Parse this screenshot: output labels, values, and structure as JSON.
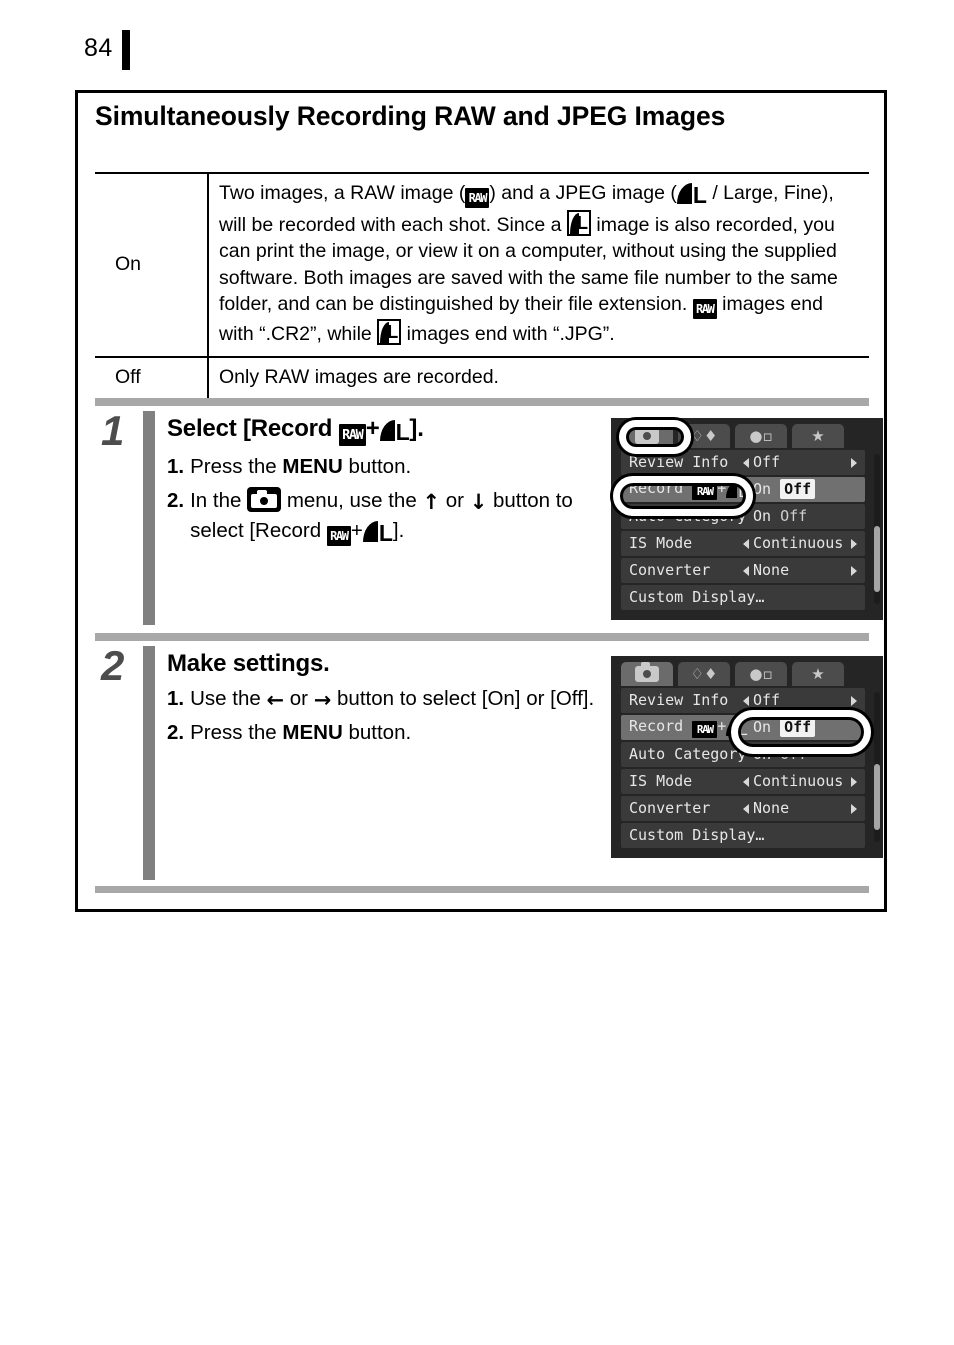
{
  "page": {
    "number": "84"
  },
  "section": {
    "title": "Simultaneously Recording RAW and JPEG Images"
  },
  "table": {
    "rows": [
      {
        "label": "On",
        "text_parts": {
          "p1": "Two images, a RAW image (",
          "p2": ") and a JPEG image (",
          "p3": "/ Large, Fine), will be recorded with each shot. Since a",
          "p4": "image is also recorded, you can print the image, or view it on a computer, without using the supplied software. Both images are saved with the same file number to the same folder, and can be distinguished by their file extension.",
          "p5": "images end with “.CR2”, while",
          "p6": "images end with “.JPG”."
        }
      },
      {
        "label": "Off",
        "text": "Only RAW images are recorded."
      }
    ]
  },
  "steps": [
    {
      "number": "1",
      "title_parts": {
        "pre": "Select [Record",
        "plus": "+",
        "post": "]."
      },
      "substeps": [
        {
          "num": "1.",
          "parts": {
            "pre": "Press the",
            "bold": "MENU",
            "post": "button."
          }
        },
        {
          "num": "2.",
          "parts": {
            "pre": "In the",
            "mid": "menu, use the",
            "or": "or",
            "post": "button to select [Record",
            "plus": "+",
            "end": "]."
          }
        }
      ]
    },
    {
      "number": "2",
      "title_parts": {
        "pre": "Make settings.",
        "plus": "",
        "post": ""
      },
      "substeps": [
        {
          "num": "1.",
          "parts": {
            "pre": "Use the",
            "or": "or",
            "post": "button to select [On] or [Off]."
          }
        },
        {
          "num": "2.",
          "parts": {
            "pre": "Press the",
            "bold": "MENU",
            "post": "button."
          }
        }
      ]
    }
  ],
  "lcd": {
    "tabs": [
      {
        "name": "shooting-tab",
        "glyph": ""
      },
      {
        "name": "setup-tab",
        "glyph": "ΨΙ"
      },
      {
        "name": "my-camera-tab",
        "glyph": "♁"
      },
      {
        "name": "favorites-tab",
        "glyph": "★"
      }
    ],
    "rows": [
      {
        "label": "Review Info",
        "value": "Off",
        "type": "arrows"
      },
      {
        "label_pre": "Record",
        "label_plus": "+",
        "value_on": "On",
        "value_off": "Off",
        "type": "toggle"
      },
      {
        "label": "Auto Category",
        "value_on": "On",
        "value_off": "Off",
        "type": "toggle-dim"
      },
      {
        "label": "IS Mode",
        "value": "Continuous",
        "type": "arrows"
      },
      {
        "label": "Converter",
        "value": "None",
        "type": "arrows"
      },
      {
        "label": "Custom Display…",
        "value": "",
        "type": "plain"
      }
    ]
  },
  "icons": {
    "raw": "RAW",
    "large_l": "L",
    "arrow_up": "↑",
    "arrow_down": "↓",
    "arrow_left": "←",
    "arrow_right": "→"
  },
  "colors": {
    "step_number": "#4d4d4d",
    "step_bar": "#808080",
    "separator": "#a8a8a8",
    "lcd_bg": "#252525",
    "lcd_row": "#3a3a3a",
    "lcd_row_highlight": "#707070"
  }
}
